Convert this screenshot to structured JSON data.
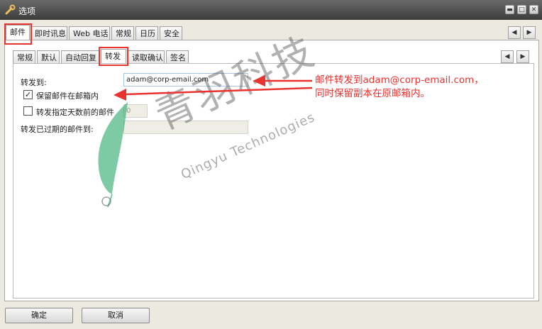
{
  "window": {
    "title": "选项",
    "minimize": "▬",
    "maximize": "□",
    "close": "✕"
  },
  "main_tabs": [
    "邮件",
    "即时讯息",
    "Web 电话",
    "常规",
    "日历",
    "安全"
  ],
  "sub_tabs": [
    "常规",
    "默认",
    "自动回复",
    "转发",
    "读取确认",
    "签名"
  ],
  "nav": {
    "left": "◀",
    "right": "▶"
  },
  "forward": {
    "forward_to_label": "转发到:",
    "forward_to_value": "adam@corp-email.com",
    "keep_copy_label": "保留邮件在邮箱内",
    "keep_copy_checked": true,
    "check_mark": "✓",
    "forward_days_label": "转发指定天数前的邮件",
    "forward_days_checked": false,
    "forward_days_value": "0",
    "expired_label": "转发已过期的邮件到:",
    "expired_value": ""
  },
  "annotation": {
    "line1": "邮件转发到adam@corp-email.com，",
    "line2": "同时保留副本在原邮箱内。",
    "color": "#e8332f"
  },
  "watermark": {
    "chinese": "青羽科技",
    "english": "Qingyu Technologies"
  },
  "footer": {
    "ok": "确定",
    "cancel": "取消"
  }
}
